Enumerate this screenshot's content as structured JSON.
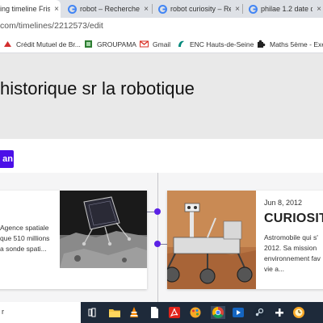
{
  "browser": {
    "tabs": [
      {
        "label": "ing timeline Fris",
        "active": true
      },
      {
        "label": "robot – Recherche G",
        "active": false
      },
      {
        "label": "robot curiosity – Rec",
        "active": false
      },
      {
        "label": "philae 1.2 date de c",
        "active": false
      }
    ],
    "close_glyph": "×",
    "url": "com/timelines/2212573/edit",
    "bookmarks": [
      {
        "label": "Crédit Mutuel de Br...",
        "icon": "bank-icon",
        "color": "#d32f2f"
      },
      {
        "label": "GROUPAMA",
        "icon": "groupama-icon",
        "color": "#2e7d32"
      },
      {
        "label": "Gmail",
        "icon": "gmail-icon",
        "color": "#d93025"
      },
      {
        "label": "ENC Hauts-de-Seine",
        "icon": "enc-icon",
        "color": "#00897b"
      },
      {
        "label": "Maths 5ème - Exerc",
        "icon": "puzzle-icon",
        "color": "#222222"
      }
    ]
  },
  "page": {
    "title": "historique sr la robotique",
    "button_label": "an",
    "accent": "#4b0fe8"
  },
  "timeline": {
    "left_card": {
      "lines": [
        "Agence spatiale",
        "que 510 millions",
        "a sonde spati..."
      ]
    },
    "right_card": {
      "date": "Jun 8, 2012",
      "title": "CURIOSIT",
      "lines": [
        "Astromobile qui s'",
        "2012. Sa mission",
        "environnement fav",
        "vie a..."
      ]
    },
    "dot_color": "#5b21e6"
  },
  "taskbar": {
    "search_text": "r",
    "apps": [
      "task-view-icon",
      "file-explorer-icon",
      "vlc-icon",
      "document-icon",
      "acrobat-icon",
      "paint-icon",
      "chrome-icon",
      "media-icon",
      "steam-icon",
      "plus-icon",
      "clock-app-icon"
    ]
  }
}
